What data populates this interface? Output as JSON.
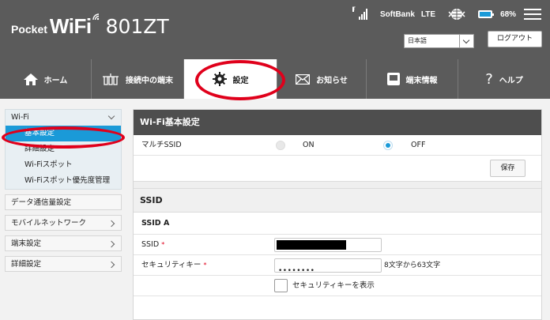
{
  "header": {
    "logo_pocket": "Pocket",
    "logo_wifi": "WiFi",
    "logo_model": "801ZT",
    "signal_type": "T",
    "carrier": "SoftBank",
    "network": "LTE",
    "battery": "68%",
    "battery_level_percent": 68,
    "language": "日本語",
    "logout": "ログアウト"
  },
  "nav": {
    "items": [
      {
        "label": "ホーム",
        "icon": "home-icon"
      },
      {
        "label": "接続中の端末",
        "icon": "devices-icon"
      },
      {
        "label": "設定",
        "icon": "gear-icon",
        "active": true
      },
      {
        "label": "お知らせ",
        "icon": "mail-icon"
      },
      {
        "label": "端末情報",
        "icon": "device-info-icon"
      },
      {
        "label": "ヘルプ",
        "icon": "help-icon"
      }
    ]
  },
  "sidebar": {
    "group": "Wi-Fi",
    "subitems": [
      "基本設定",
      "詳細設定",
      "Wi-Fiスポット",
      "Wi-Fiスポット優先度管理"
    ],
    "items": [
      "データ通信量設定",
      "モバイルネットワーク",
      "端末設定",
      "詳細設定"
    ]
  },
  "main": {
    "title": "Wi-Fi基本設定",
    "multi_ssid_label": "マルチSSID",
    "on_label": "ON",
    "off_label": "OFF",
    "multi_ssid_value": "OFF",
    "save_label": "保存",
    "ssid_section": "SSID",
    "ssid_a": "SSID A",
    "ssid_label": "SSID",
    "security_key_label": "セキュリティキー",
    "security_key_value": "••••••••",
    "security_hint": "8文字から63文字",
    "show_key_label": "セキュリティキーを表示"
  },
  "colors": {
    "header_bg": "#5b5b5b",
    "accent": "#1a9ad8",
    "highlight_ring": "#e0001b"
  }
}
